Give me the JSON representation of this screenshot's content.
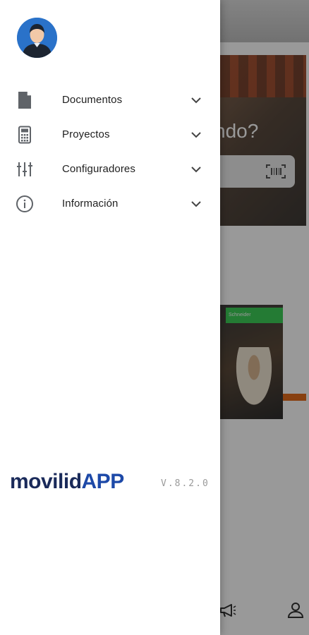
{
  "background": {
    "hero_text": "ndo?",
    "card_brand": "Schneider",
    "icons": [
      "barcode-icon",
      "megaphone-icon",
      "person-icon"
    ]
  },
  "drawer": {
    "menu": [
      {
        "label": "Documentos",
        "icon": "document-icon"
      },
      {
        "label": "Proyectos",
        "icon": "calculator-icon"
      },
      {
        "label": "Configuradores",
        "icon": "sliders-icon"
      },
      {
        "label": "Información",
        "icon": "info-icon"
      }
    ],
    "brand_part1": "movilid",
    "brand_part2": "APP",
    "version": "V.8.2.0"
  },
  "colors": {
    "brand_dark": "#1a2a5a",
    "brand_blue": "#1d49a8",
    "avatar_bg": "#2a72c9"
  }
}
